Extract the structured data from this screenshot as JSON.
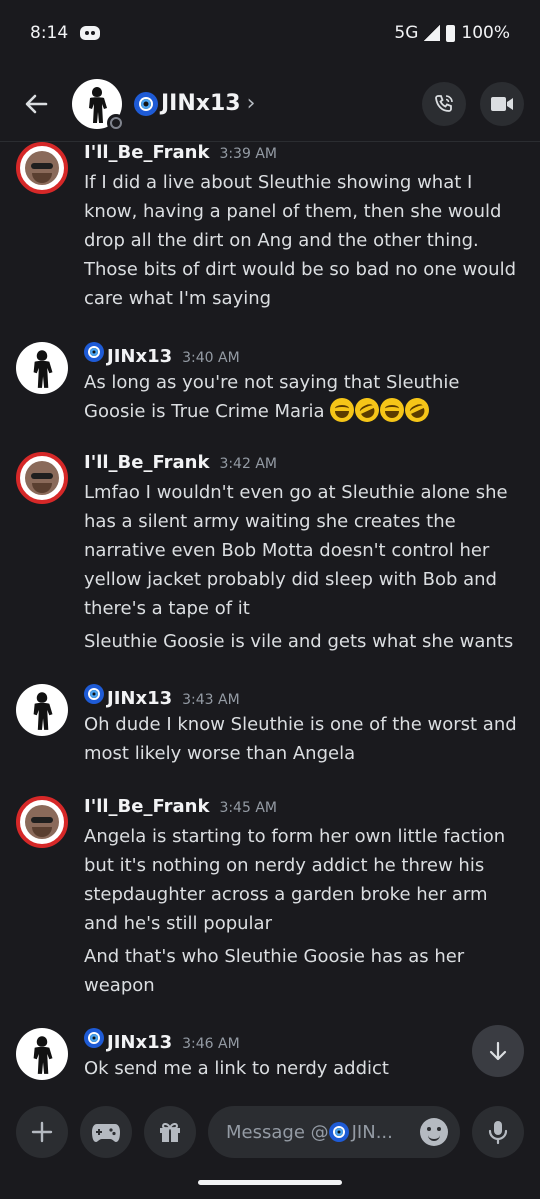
{
  "status_bar": {
    "time": "8:14",
    "network": "5G",
    "battery": "100%"
  },
  "header": {
    "title": "JINx13",
    "chevron": "›"
  },
  "messages": [
    {
      "author": "I'll_Be_Frank",
      "time": "3:39 AM",
      "lines": [
        "If I did a live about Sleuthie showing what I know, having a panel of them, then she would drop all the dirt on Ang and the other thing. Those bits of dirt would be so bad no one would care what I'm saying"
      ]
    },
    {
      "author": "JINx13",
      "time": "3:40 AM",
      "lines": [
        "As long as you're not saying that Sleuthie Goosie is True Crime Maria"
      ]
    },
    {
      "author": "I'll_Be_Frank",
      "time": "3:42 AM",
      "lines": [
        "Lmfao I wouldn't even go at Sleuthie alone she has a silent army waiting she creates the narrative even Bob Motta doesn't control her yellow jacket probably did sleep with Bob and there's a tape of it",
        "Sleuthie Goosie is vile and gets what she wants"
      ]
    },
    {
      "author": "JINx13",
      "time": "3:43 AM",
      "lines": [
        "Oh dude I know Sleuthie is one of the worst and most likely worse than Angela"
      ]
    },
    {
      "author": "I'll_Be_Frank",
      "time": "3:45 AM",
      "lines": [
        "Angela is starting to form her own little faction but it's nothing on nerdy addict he threw his stepdaughter across a garden broke her arm and he's still popular",
        "And that's who Sleuthie Goosie has as her weapon"
      ]
    },
    {
      "author": "JINx13",
      "time": "3:46 AM",
      "lines": [
        "Ok send me a link to nerdy addict"
      ]
    }
  ],
  "composer": {
    "placeholder_prefix": "Message @",
    "placeholder_suffix": "JIN..."
  },
  "icons": {
    "back": "arrow-left-icon",
    "call": "phone-icon",
    "video": "video-icon",
    "plus": "plus-icon",
    "games": "gamepad-icon",
    "gift": "gift-icon",
    "emoji": "emoji-icon",
    "mic": "microphone-icon",
    "scroll": "arrow-down-icon"
  },
  "colors": {
    "background": "#1a1a1e",
    "surface": "#2b2d31",
    "frank_ring": "#d62828",
    "nazar_blue": "#1e5bd6"
  }
}
